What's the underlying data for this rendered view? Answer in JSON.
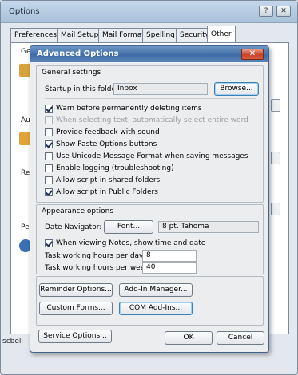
{
  "outer_window": {
    "title": "Options",
    "help_button": "?",
    "close_button": "✕",
    "tabs": [
      {
        "label": "Preferences"
      },
      {
        "label": "Mail Setup"
      },
      {
        "label": "Mail Format"
      },
      {
        "label": "Spelling"
      },
      {
        "label": "Security"
      },
      {
        "label": "Other"
      }
    ],
    "active_tab": "Other",
    "peek_labels": [
      "Ger",
      "Aut",
      "Rea",
      "Per"
    ],
    "peek_bottom_text": "scbell"
  },
  "dialog": {
    "title": "Advanced Options",
    "close_label": "✕",
    "general": {
      "heading": "General settings",
      "startup_label": "Startup in this folder:",
      "startup_value": "Inbox",
      "browse_label": "Browse...",
      "options": [
        {
          "label": "Warn before permanently deleting items",
          "checked": true,
          "disabled": false
        },
        {
          "label": "When selecting text, automatically select entire word",
          "checked": false,
          "disabled": true
        },
        {
          "label": "Provide feedback with sound",
          "checked": false,
          "disabled": false
        },
        {
          "label": "Show Paste Options buttons",
          "checked": true,
          "disabled": false
        },
        {
          "label": "Use Unicode Message Format when saving messages",
          "checked": false,
          "disabled": false
        },
        {
          "label": "Enable logging (troubleshooting)",
          "checked": false,
          "disabled": false
        },
        {
          "label": "Allow script in shared folders",
          "checked": false,
          "disabled": false
        },
        {
          "label": "Allow script in Public Folders",
          "checked": true,
          "disabled": false
        }
      ]
    },
    "appearance": {
      "heading": "Appearance options",
      "date_nav_label": "Date Navigator:",
      "font_button": "Font...",
      "font_value": "8 pt. Tahoma",
      "notes_option": {
        "label": "When viewing Notes, show time and date",
        "checked": true
      },
      "hours_day_label": "Task working hours per day:",
      "hours_day_value": "8",
      "hours_week_label": "Task working hours per week:",
      "hours_week_value": "40"
    },
    "buttons": {
      "reminder": "Reminder Options...",
      "addin_manager": "Add-In Manager...",
      "custom_forms": "Custom Forms...",
      "com_addins": "COM Add-Ins...",
      "service": "Service Options...",
      "ok": "OK",
      "cancel": "Cancel"
    }
  },
  "colors": {
    "titlebar": "#3e6ca6",
    "close_button": "#c8442a",
    "dialog_bg": "#ecedee"
  }
}
